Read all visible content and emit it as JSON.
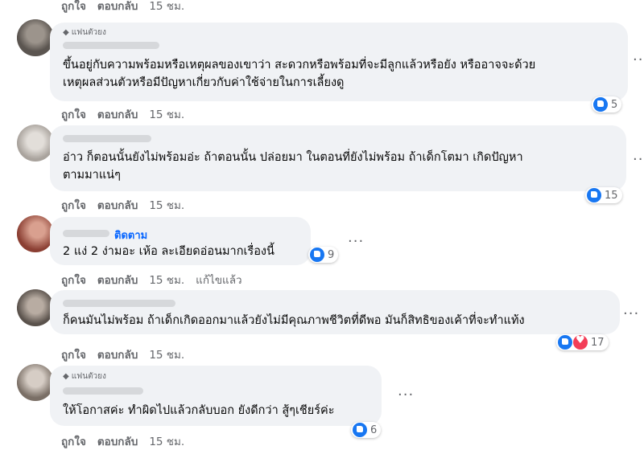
{
  "comments": [
    {
      "badge": "",
      "text_lines": [],
      "actions": {
        "like": "ถูกใจ",
        "reply": "ตอบกลับ",
        "time": "15 ชม."
      }
    },
    {
      "badge": "แฟนตัวยง",
      "text_lines": [
        "ขึ้นอยู่กับความพร้อมหรือเหตุผลของเขาว่า สะดวกหรือพร้อมที่จะมีลูกแล้วหรือยัง หรืออาจจะด้วย",
        "เหตุผลส่วนตัวหรือมีปัญหาเกี่ยวกับค่าใช้จ่ายในการเลี้ยงดู"
      ],
      "reaction_count": "5",
      "actions": {
        "like": "ถูกใจ",
        "reply": "ตอบกลับ",
        "time": "15 ชม."
      }
    },
    {
      "badge": "",
      "text_lines": [
        "อ่าว ก็ตอนนั้นยังไม่พร้อมอ่ะ ถ้าตอนนั้น ปล่อยมา ในตอนที่ยังไม่พร้อม ถ้าเด็กโตมา เกิดปัญหา",
        "ตามมาแน่ๆ"
      ],
      "reaction_count": "15",
      "actions": {
        "like": "ถูกใจ",
        "reply": "ตอบกลับ",
        "time": "15 ชม."
      }
    },
    {
      "badge": "",
      "follow": "ติดตาม",
      "text_lines": [
        "2 แง่ 2 ง่ามอะ เห้อ ละเอียดอ่อนมากเรื่องนี้"
      ],
      "reaction_count": "9",
      "actions": {
        "like": "ถูกใจ",
        "reply": "ตอบกลับ",
        "time": "15 ชม.",
        "edited": "แก้ไขแล้ว"
      }
    },
    {
      "badge": "",
      "text_lines": [
        "ก็คนมันไม่พร้อม ถ้าเด็กเกิดออกมาแล้วยังไม่มีคุณภาพชีวิตที่ดีพอ มันก็สิทธิของเค้าที่จะทำแท้ง"
      ],
      "reaction_count": "17",
      "actions": {
        "like": "ถูกใจ",
        "reply": "ตอบกลับ",
        "time": "15 ชม."
      }
    },
    {
      "badge": "แฟนตัวยง",
      "text_lines": [
        "ให้โอกาสค่ะ ทำผิดไปแล้วกลับบอก ยังดีกว่า สู้ๆเชียร์ค่ะ"
      ],
      "reaction_count": "6",
      "actions": {
        "like": "ถูกใจ",
        "reply": "ตอบกลับ",
        "time": "15 ชม."
      }
    }
  ],
  "more_label": "···",
  "icons": {
    "badge": "diamond-icon",
    "like": "like-icon",
    "love": "love-icon"
  },
  "colors": {
    "bubble": "#f0f2f5",
    "like_blue": "#1877f2",
    "love_red": "#f33e58",
    "link_blue": "#0866ff",
    "meta_gray": "#65676b"
  }
}
